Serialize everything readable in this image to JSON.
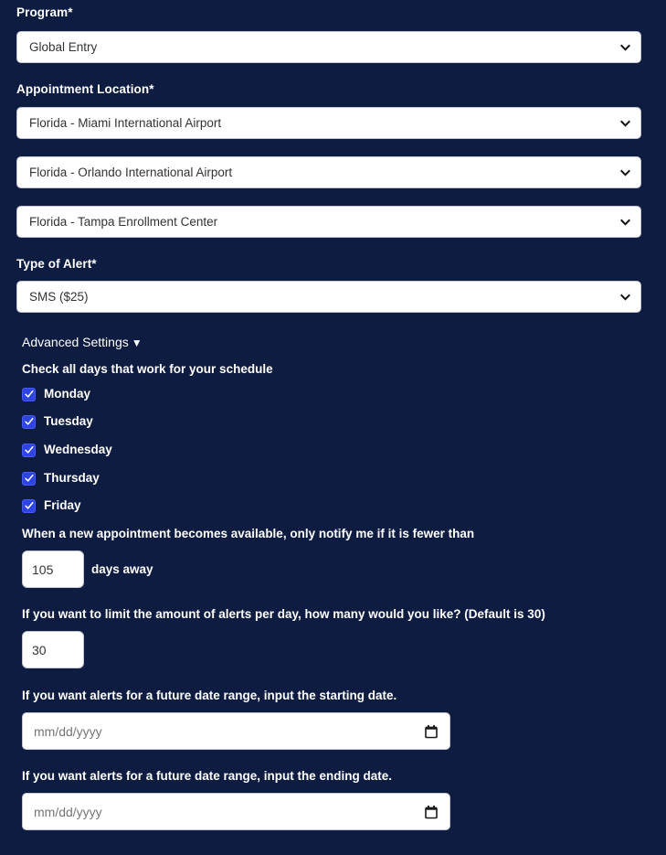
{
  "form": {
    "program": {
      "label": "Program*",
      "value": "Global Entry",
      "icon": "chevron-down-icon"
    },
    "appointment_location": {
      "label": "Appointment Location*",
      "values": [
        "Florida - Miami International Airport",
        "Florida - Orlando International Airport",
        "Florida - Tampa Enrollment Center"
      ]
    },
    "alert_type": {
      "label": "Type of Alert*",
      "value": "SMS ($25)"
    },
    "advanced_settings": {
      "label": "Advanced Settings",
      "caret": "▼",
      "expanded": true
    },
    "days": {
      "heading": "Check all days that work for your schedule",
      "items": [
        {
          "label": "Monday",
          "checked": true
        },
        {
          "label": "Tuesday",
          "checked": true
        },
        {
          "label": "Wednesday",
          "checked": true
        },
        {
          "label": "Thursday",
          "checked": true
        },
        {
          "label": "Friday",
          "checked": true
        }
      ]
    },
    "days_away": {
      "label": "When a new appointment becomes available, only notify me if it is fewer than",
      "value": "105",
      "suffix": "days away"
    },
    "alerts_per_day": {
      "label": "If you want to limit the amount of alerts per day, how many would you like? (Default is 30)",
      "value": "30"
    },
    "start_date": {
      "label": "If you want alerts for a future date range, input the starting date.",
      "value": "",
      "placeholder": "mm/dd/yyyy",
      "icon": "calendar-icon"
    },
    "end_date": {
      "label": "If you want alerts for a future date range, input the ending date.",
      "value": "",
      "placeholder": "mm/dd/yyyy",
      "icon": "calendar-icon"
    }
  },
  "colors": {
    "background": "#0e1c42",
    "field_background": "#ffffff",
    "checkbox_accent": "#2f44e8",
    "label_text": "#ffffff",
    "input_text": "#333333"
  }
}
